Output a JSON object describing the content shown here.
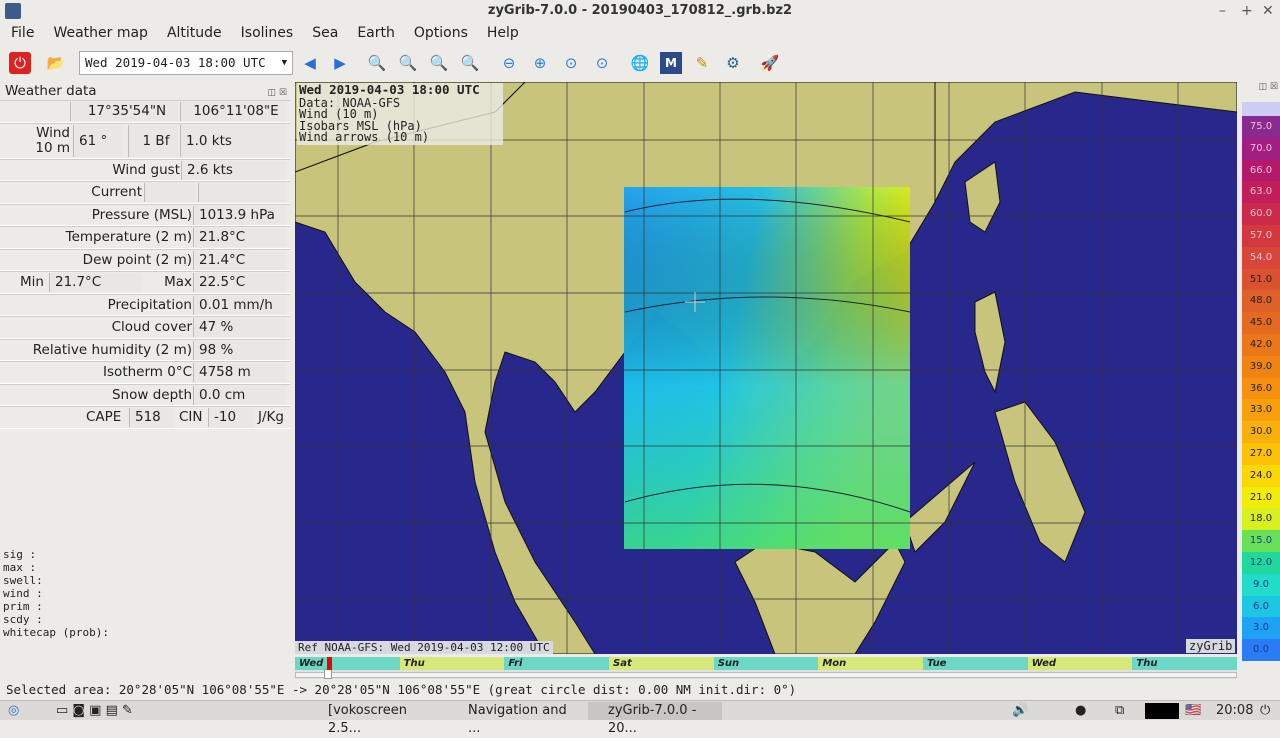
{
  "window": {
    "title": "zyGrib-7.0.0 - 20190403_170812_.grb.bz2"
  },
  "menu": [
    "File",
    "Weather map",
    "Altitude",
    "Isolines",
    "Sea",
    "Earth",
    "Options",
    "Help"
  ],
  "toolbar": {
    "date": "Wed 2019-04-03 18:00 UTC"
  },
  "panel": {
    "title": "Weather data",
    "lat": "17°35'54\"N",
    "lon": "106°11'08\"E",
    "wind_label": "Wind\n10 m",
    "wind_dir": "61 °",
    "wind_bf": "1 Bf",
    "wind_speed": "1.0  kts",
    "rows": [
      {
        "label": "Wind gust",
        "value": "2.6  kts"
      },
      {
        "label": "Current",
        "value": ""
      },
      {
        "label": "Pressure (MSL)",
        "value": "1013.9 hPa"
      },
      {
        "label": "Temperature (2 m)",
        "value": "21.8°C"
      },
      {
        "label": "Dew point (2 m)",
        "value": "21.4°C"
      }
    ],
    "min_label": "Min",
    "min_value": "21.7°C",
    "max_label": "Max",
    "max_value": "22.5°C",
    "rows2": [
      {
        "label": "Precipitation",
        "value": "0.01 mm/h"
      },
      {
        "label": "Cloud cover",
        "value": "47 %"
      },
      {
        "label": "Relative humidity (2 m)",
        "value": "98 %"
      },
      {
        "label": "Isotherm 0°C",
        "value": "4758 m"
      },
      {
        "label": "Snow depth",
        "value": "0.0 cm"
      }
    ],
    "cape_label": "CAPE",
    "cape_value": "518",
    "cin_label": "CIN",
    "cin_value": "-10",
    "cape_unit": "J/Kg",
    "sea_lines": [
      "sig  :",
      "max  :",
      "swell:",
      "wind :",
      "prim :",
      "scdy :",
      "whitecap (prob):"
    ]
  },
  "map": {
    "legend": [
      "Wed 2019-04-03 18:00 UTC",
      "Data: NOAA-GFS",
      "Wind (10 m)",
      "Isobars MSL (hPa)",
      "Wind arrows (10 m)"
    ],
    "ref": "Ref NOAA-GFS: Wed 2019-04-03 12:00 UTC",
    "brand": "zyGrib",
    "colors": {
      "sea": "#28278c",
      "land": "#c9c47b"
    }
  },
  "colorbar": {
    "values": [
      "75.0",
      "70.0",
      "66.0",
      "63.0",
      "60.0",
      "57.0",
      "54.0",
      "51.0",
      "48.0",
      "45.0",
      "42.0",
      "39.0",
      "36.0",
      "33.0",
      "30.0",
      "27.0",
      "24.0",
      "21.0",
      "18.0",
      "15.0",
      "12.0",
      "9.0",
      "6.0",
      "3.0",
      "0.0"
    ],
    "colors": [
      "#8a2a8e",
      "#a21f82",
      "#b41a6c",
      "#c21e5a",
      "#cc2a4a",
      "#d4383e",
      "#d8463a",
      "#db5230",
      "#df6028",
      "#e36a20",
      "#ea7818",
      "#f08412",
      "#f6900e",
      "#f8a00c",
      "#fab00a",
      "#fcc208",
      "#fad805",
      "#f2ec06",
      "#d9f020",
      "#6ae05a",
      "#1ed89c",
      "#20dcc8",
      "#1ec6e6",
      "#1ea2f4",
      "#2a7cf2"
    ]
  },
  "timeline": {
    "days": [
      "Wed",
      "Thu",
      "Fri",
      "Sat",
      "Sun",
      "Mon",
      "Tue",
      "Wed",
      "Thu"
    ],
    "position": 0.03
  },
  "status": "Selected area:  20°28'05\"N  106°08'55\"E ->  20°28'05\"N  106°08'55\"E   (great circle dist: 0.00 NM  init.dir: 0°)",
  "taskbar": {
    "tasks": [
      "[vokoscreen 2.5...",
      "Navigation and ...",
      "zyGrib-7.0.0 - 20..."
    ],
    "clock": "20:08"
  }
}
